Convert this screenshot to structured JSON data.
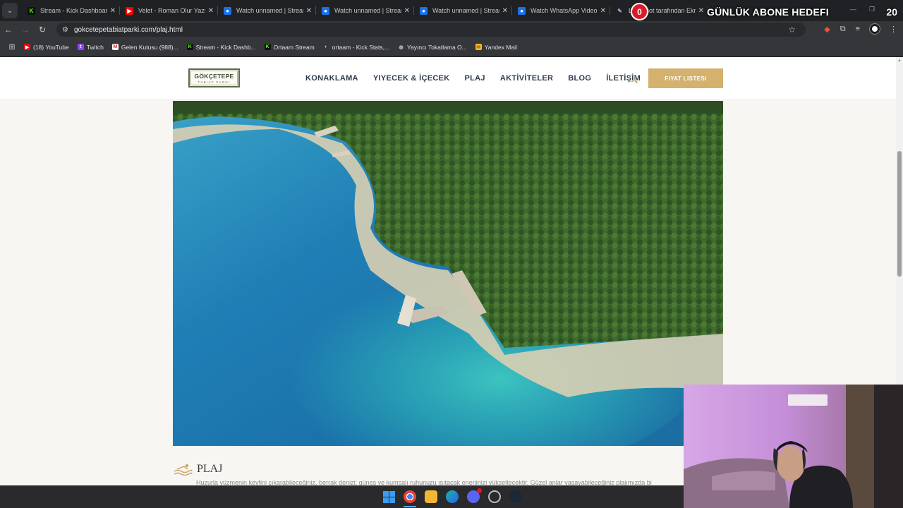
{
  "tabs": [
    {
      "title": "Stream - Kick Dashboard",
      "favicon": "kick"
    },
    {
      "title": "Velet - Roman Olur Yazsa",
      "favicon": "yt"
    },
    {
      "title": "Watch unnamed | Stream",
      "favicon": "watch"
    },
    {
      "title": "Watch unnamed | Stream",
      "favicon": "watch"
    },
    {
      "title": "Watch unnamed | Stream",
      "favicon": "watch"
    },
    {
      "title": "Watch WhatsApp Video",
      "favicon": "watch"
    },
    {
      "title": "Lightshot tarafından Ekra",
      "favicon": "pen"
    }
  ],
  "overlay": {
    "subs": "0",
    "title": "GÜNLÜK ABONE HEDEFI",
    "goal": "20"
  },
  "address": {
    "url": "gokcetepetabiatparki.com/plaj.html"
  },
  "bookmarks": [
    {
      "label": "(18) YouTube",
      "icon": "yt",
      "glyph": "▶"
    },
    {
      "label": "Twitch",
      "icon": "tw",
      "glyph": "t"
    },
    {
      "label": "Gelen Kutusu (988)...",
      "icon": "gm",
      "glyph": "M"
    },
    {
      "label": "Stream - Kick Dashb...",
      "icon": "kick",
      "glyph": "K"
    },
    {
      "label": "Ortaam Stream",
      "icon": "kick",
      "glyph": "K"
    },
    {
      "label": "ortaam - Kick Stats,...",
      "icon": "glob",
      "glyph": "◐"
    },
    {
      "label": "Yayıncı Tokatlama O...",
      "icon": "glob",
      "glyph": "◍"
    },
    {
      "label": "Yandex Mail",
      "icon": "mail",
      "glyph": "✉"
    }
  ],
  "site": {
    "logo_line1": "GÖKÇETEPE",
    "logo_line2": "TABIAT PARKI",
    "menu": [
      "KONAKLAMA",
      "YIYECEK & İÇECEK",
      "PLAJ",
      "AKTİVİTELER",
      "BLOG",
      "İLETİŞİM"
    ],
    "price_button": "FIYAT LISTESI",
    "section_title": "PLAJ",
    "section_text": "Huzurla yüzmenin keyfini çıkarabileceğiniz, berrak denizi; güneş ve kumsalı ruhunuzu ısıtacak enerjinizi yükseltecektir. Güzel anlar yaşayabileceğiniz plajımızda bi"
  },
  "colors": {
    "accent_gold": "#d4b16f",
    "menu_text": "#2e3b4e",
    "logo_green": "#5c6b4a"
  }
}
